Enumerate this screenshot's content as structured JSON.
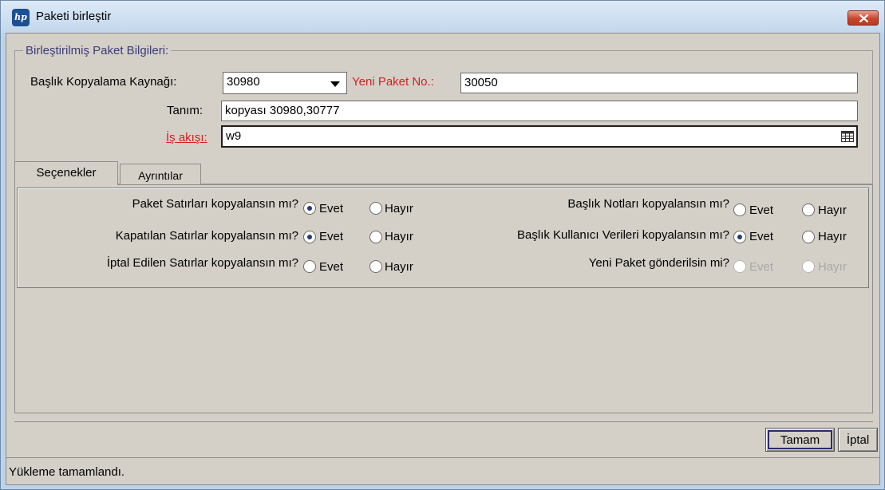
{
  "window": {
    "title": "Paketi birleştir",
    "app_icon_text": "hp"
  },
  "merged_info": {
    "group_title": "Birleştirilmiş Paket Bilgileri:",
    "header_copy_source_label": "Başlık Kopyalama Kaynağı:",
    "header_copy_source_value": "30980",
    "new_package_no_label": "Yeni Paket No.:",
    "new_package_no_value": "30050",
    "description_label": "Tanım:",
    "description_value": "kopyası 30980,30777",
    "workflow_label": "İş akışı:",
    "workflow_value": "w9"
  },
  "tabs": [
    {
      "label": "Seçenekler",
      "active": true
    },
    {
      "label": "Ayrıntılar",
      "active": false
    }
  ],
  "options": {
    "yes": "Evet",
    "no": "Hayır",
    "left": [
      {
        "question": "Paket Satırları kopyalansın mı?",
        "selected": "yes"
      },
      {
        "question": "Kapatılan Satırlar kopyalansın mı?",
        "selected": "yes"
      },
      {
        "question": "İptal Edilen Satırlar kopyalansın mı?",
        "selected": "none"
      }
    ],
    "right": [
      {
        "question": "Başlık Notları kopyalansın mı?",
        "selected": "none"
      },
      {
        "question": "Başlık Kullanıcı Verileri kopyalansın mı?",
        "selected": "yes"
      },
      {
        "question": "Yeni Paket gönderilsin mi?",
        "selected": "none",
        "disabled": true
      }
    ]
  },
  "buttons": {
    "ok": "Tamam",
    "cancel": "İptal"
  },
  "status": {
    "text": "Yükleme tamamlandı."
  }
}
